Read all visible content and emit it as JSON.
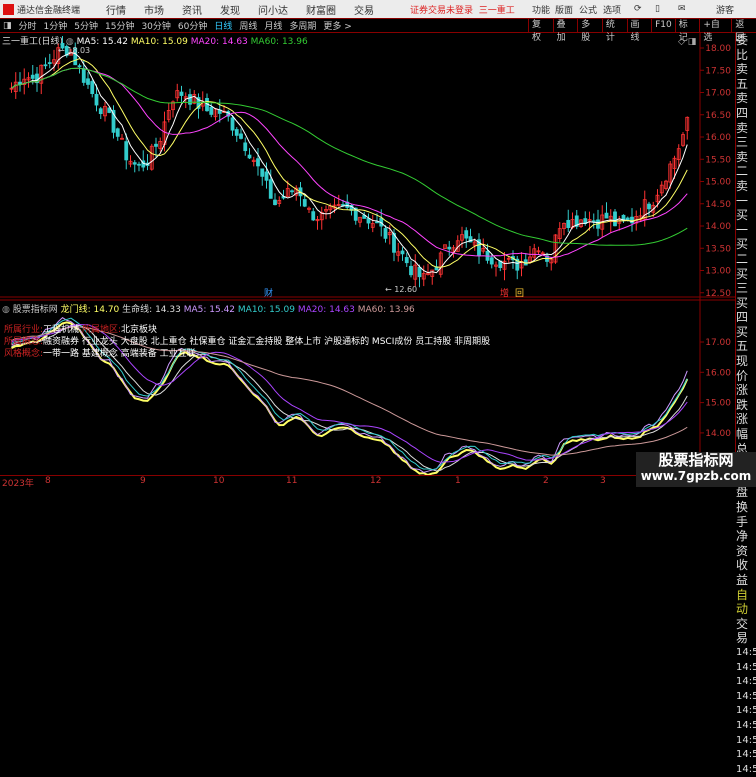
{
  "app": {
    "name": "通达信金融终端",
    "menu": [
      "行情",
      "市场",
      "资讯",
      "发现",
      "问小达",
      "财富圈",
      "交易"
    ],
    "login_status": "证券交易未登录",
    "stock_title": "三一重工",
    "right_menu": [
      "功能",
      "版面",
      "公式",
      "选项"
    ],
    "user": "游客"
  },
  "periods": [
    "分时",
    "1分钟",
    "5分钟",
    "15分钟",
    "30分钟",
    "60分钟",
    "日线",
    "周线",
    "月线",
    "多周期",
    "更多 >"
  ],
  "active_period": "日线",
  "tools": [
    "复权",
    "叠加",
    "多股",
    "统计",
    "画线",
    "F10",
    "标记",
    "+自选",
    "返回"
  ],
  "main": {
    "title": "三一重工(日线)",
    "ma5": "MA5: 15.42",
    "ma10": "MA10: 15.09",
    "ma20": "MA20: 14.63",
    "ma60": "MA60: 13.96",
    "high_label": "18.03",
    "low_label": "12.60",
    "mark_cai": "财",
    "mark_zeng": "增",
    "mark_hui": "回",
    "yticks": [
      "18.00",
      "17.50",
      "17.00",
      "16.50",
      "16.00",
      "15.50",
      "15.00",
      "14.50",
      "14.00",
      "13.50",
      "13.00",
      "12.50"
    ],
    "closes": [
      17.1,
      17.4,
      17.3,
      17.6,
      17.9,
      18.0,
      17.5,
      17.0,
      16.6,
      16.2,
      15.6,
      15.3,
      15.5,
      16.0,
      16.9,
      17.0,
      16.8,
      16.6,
      16.6,
      16.4,
      16.0,
      15.6,
      15.0,
      14.5,
      14.7,
      14.9,
      14.3,
      14.2,
      14.3,
      14.4,
      14.3,
      14.2,
      14.0,
      13.7,
      13.4,
      13.0,
      12.8,
      13.1,
      13.5,
      13.8,
      13.6,
      13.4,
      13.3,
      13.2,
      13.1,
      13.3,
      13.6,
      13.2,
      14.2,
      14.1,
      14.2,
      14.1,
      14.2,
      14.0,
      14.1,
      14.4,
      14.6,
      15.1,
      15.6,
      16.3
    ]
  },
  "indicator": {
    "name": "股票指标网",
    "longmen": "龙门线: 14.70",
    "shengming": "生命线: 14.33",
    "ma5": "MA5: 15.42",
    "ma10": "MA10: 15.09",
    "ma20": "MA20: 14.63",
    "ma60": "MA60: 13.96",
    "industry_label": "所属行业:",
    "industry": "工程机械",
    "region_label": "所属地区:",
    "region": "北京板块",
    "concept_label": "所属概念:",
    "concepts": "融资融券 行业龙头 大盘股 北上重仓 社保重仓 证金汇金持股 整体上市 沪股通标的 MSCI成份 员工持股 非周期股",
    "style_label": "风格概念:",
    "styles": "一带一路 基建概念 高端装备 工业互联",
    "yticks": [
      "17.00",
      "16.00",
      "15.00",
      "14.00"
    ]
  },
  "dates": [
    "2023年",
    "8",
    "9",
    "10",
    "11",
    "12",
    "1",
    "2",
    "3"
  ],
  "right_panel": [
    "委比",
    "卖五",
    "卖四",
    "卖三",
    "卖二",
    "卖一",
    "买一",
    "买二",
    "买三",
    "买四",
    "买五",
    "现价",
    "涨跌",
    "涨幅",
    "总量",
    "外盘",
    "换手",
    "净资",
    "收益",
    "自动",
    "交易",
    "14:5",
    "14:5",
    "14:5",
    "14:5",
    "14:5",
    "14:5",
    "14:5",
    "14:5",
    "14:5"
  ],
  "watermark": {
    "line1": "股票指标网",
    "line2": "www.7gpzb.com"
  },
  "colors": {
    "up": "#ff3333",
    "down": "#33cccc",
    "ma5": "#ffffff",
    "ma10": "#ffff66",
    "ma20": "#ff44ff",
    "ma60": "#33cc33"
  }
}
